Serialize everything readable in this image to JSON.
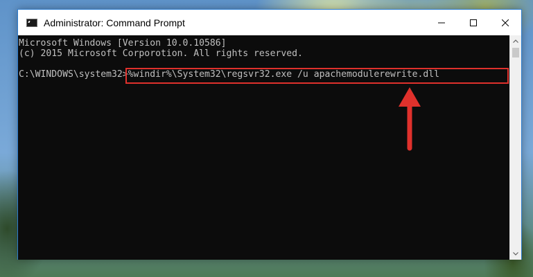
{
  "window": {
    "title": "Administrator: Command Prompt",
    "icon": "cmd-icon"
  },
  "controls": {
    "minimize_icon": "minimize-icon",
    "maximize_icon": "maximize-icon",
    "close_icon": "close-icon"
  },
  "console": {
    "line1": "Microsoft Windows [Version 10.0.10586]",
    "line2": "(c) 2015 Microsoft Corporotion. All rights reserved.",
    "prompt": "C:\\WINDOWS\\system32>",
    "command": "%windir%\\System32\\regsvr32.exe /u apachemodulerewrite.dll"
  },
  "annotation": {
    "highlight_color": "#e0312c",
    "arrow_icon": "red-arrow-up-icon"
  },
  "colors": {
    "console_bg": "#0c0c0c",
    "console_text": "#c0c0c0",
    "border": "#2b7ccf"
  }
}
